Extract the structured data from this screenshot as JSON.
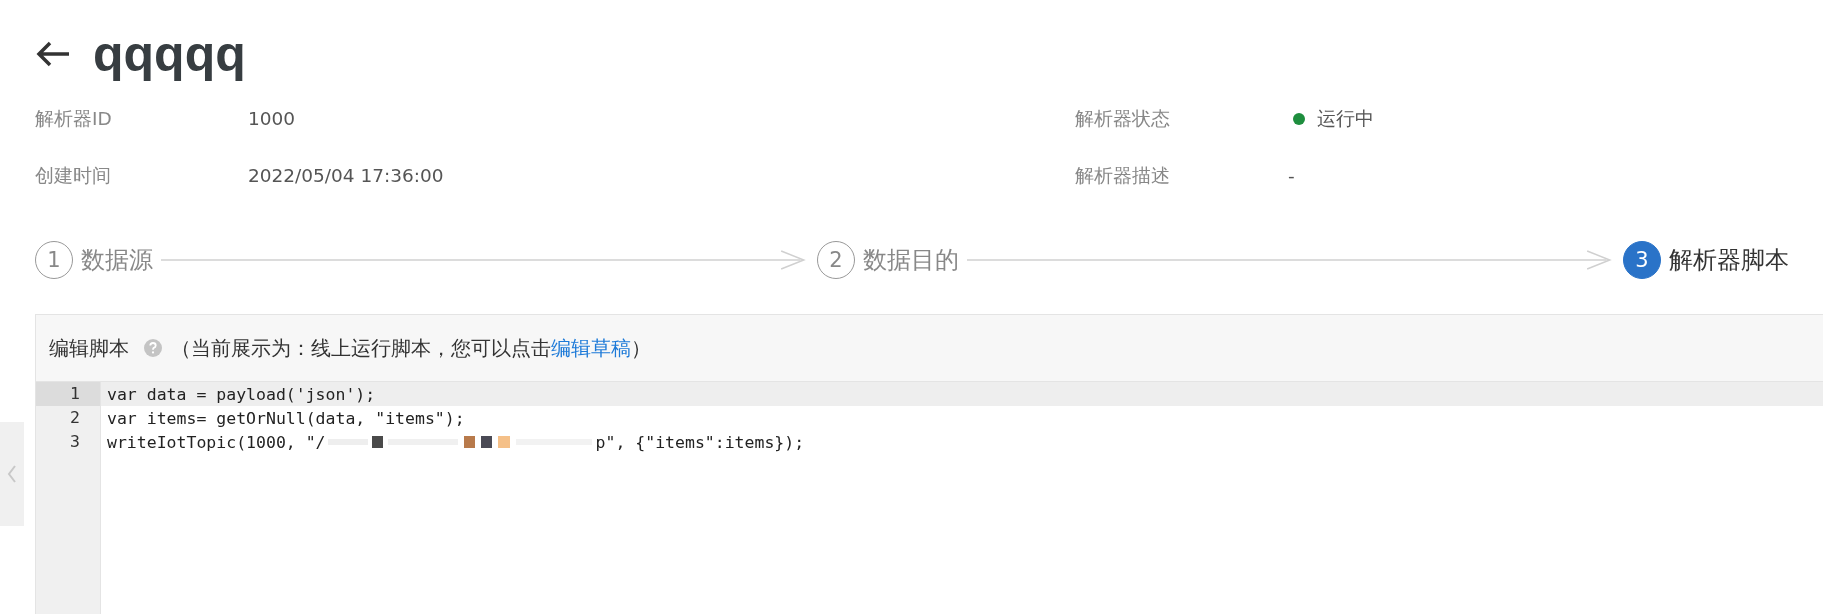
{
  "header": {
    "title": "qqqqq"
  },
  "info": [
    {
      "label": "解析器ID",
      "value": "1000"
    },
    {
      "label": "解析器状态",
      "value": "运行中",
      "color": "#1e8e3e"
    },
    {
      "label": "创建时间",
      "value": "2022/05/04 17:36:00"
    },
    {
      "label": "解析器描述",
      "value": "-"
    }
  ],
  "steps": [
    {
      "number": "1",
      "label": "数据源",
      "selected": false
    },
    {
      "number": "2",
      "label": "数据目的",
      "selected": false
    },
    {
      "number": "3",
      "label": "解析器脚本",
      "selected": true
    }
  ],
  "editor": {
    "title": "编辑脚本",
    "note_before": "（当前展示为：线上运行脚本，您可以点击",
    "link": "编辑草稿",
    "note_after": "）",
    "lines": [
      {
        "number": "1",
        "active": true,
        "parts": [
          {
            "kind": "code",
            "text": "var data = payload('json');"
          }
        ]
      },
      {
        "number": "2",
        "active": false,
        "parts": [
          {
            "kind": "code",
            "text": "var items= getOrNull(data, \"items\");"
          }
        ]
      },
      {
        "number": "3",
        "active": false,
        "parts": [
          {
            "kind": "code",
            "text": "writeIotTopic(1000, \"/"
          },
          {
            "kind": "redacted"
          },
          {
            "kind": "code",
            "text": "p\", {\"items\":items});"
          }
        ]
      }
    ]
  }
}
